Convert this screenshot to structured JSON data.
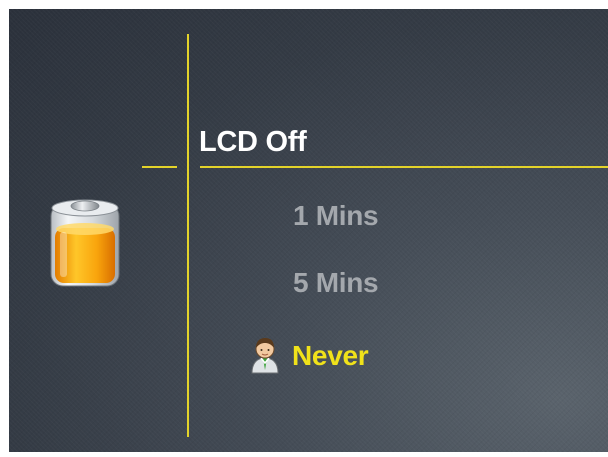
{
  "screen": {
    "title": "LCD Off",
    "options": [
      {
        "label": "1 Mins",
        "selected": false
      },
      {
        "label": "5 Mins",
        "selected": false
      },
      {
        "label": "Never",
        "selected": true
      }
    ]
  },
  "icons": {
    "battery": "battery-icon",
    "selection": "person-icon"
  },
  "colors": {
    "accent": "#e3d32a",
    "selected_text": "#f0e21a",
    "unselected_text": "#a4a8ad",
    "title_text": "#ffffff",
    "background": "#3a414b"
  }
}
